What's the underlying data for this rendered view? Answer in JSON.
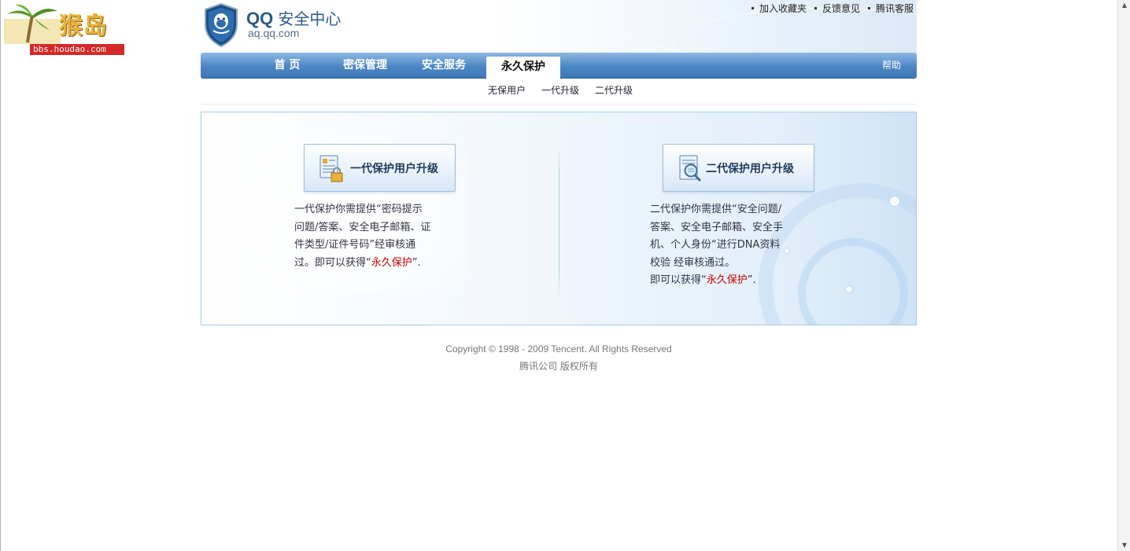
{
  "watermark": {
    "text": "猴岛",
    "url": "bbs.houdao.com"
  },
  "header": {
    "logo_title": "QQ",
    "logo_title_cn": "安全中心",
    "logo_subtitle": "aq.qq.com",
    "links": [
      "加入收藏夹",
      "反馈意见",
      "腾讯客服"
    ]
  },
  "nav": {
    "items": [
      "首  页",
      "密保管理",
      "安全服务",
      "永久保护"
    ],
    "active": "永久保护",
    "help": "帮助"
  },
  "subnav": [
    "无保用户",
    "一代升级",
    "二代升级"
  ],
  "cards": [
    {
      "button_label": "一代保护用户升级",
      "desc_lines": [
        "一代保护你需提供“密码提示",
        "问题/答案、安全电子邮箱、证",
        "件类型/证件号码”经审核通"
      ],
      "desc_tail_prefix": "过。即可以获得“",
      "desc_tail_red": "永久保护",
      "desc_tail_suffix": "”."
    },
    {
      "button_label": "二代保护用户升级",
      "desc_lines": [
        "二代保护你需提供“安全问题/",
        "答案、安全电子邮箱、安全手",
        "机、个人身份“进行DNA资料",
        "校验 经审核通过。"
      ],
      "desc_tail_prefix": "即可以获得“",
      "desc_tail_red": "永久保护",
      "desc_tail_suffix": "”."
    }
  ],
  "footer": {
    "copyright": "Copyright © 1998 - 2009 Tencent. All Rights Reserved",
    "company": "腾讯公司  版权所有"
  },
  "colors": {
    "nav_blue": "#4c86c4",
    "highlight_red": "#cc0000",
    "panel_border": "#a9cbe8"
  }
}
